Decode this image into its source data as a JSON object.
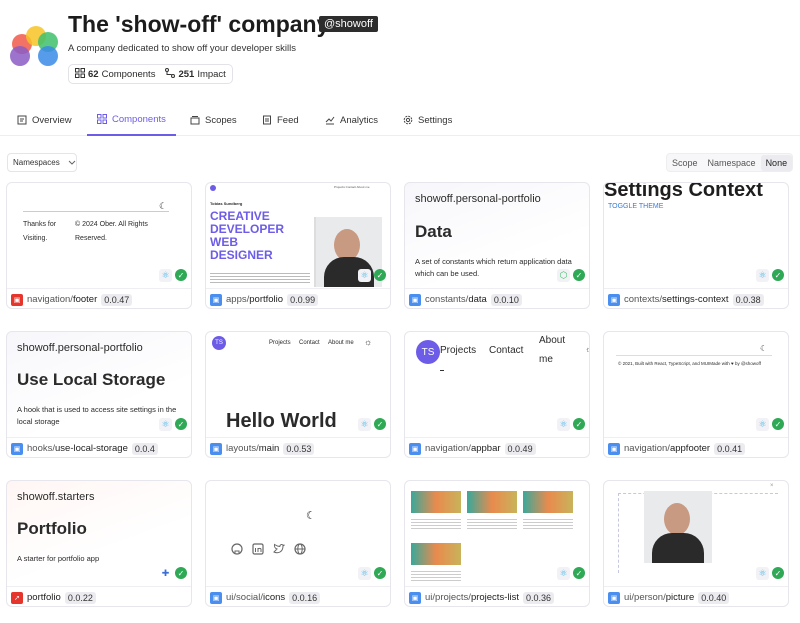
{
  "org": {
    "title": "The 'show-off' company",
    "handle": "@showoff",
    "description": "A company dedicated to show off your developer skills",
    "components_count": "62",
    "components_label": "Components",
    "impact_count": "251",
    "impact_label": "Impact"
  },
  "tabs": [
    {
      "label": "Overview",
      "icon": "overview-icon"
    },
    {
      "label": "Components",
      "icon": "components-icon",
      "active": true
    },
    {
      "label": "Scopes",
      "icon": "scopes-icon"
    },
    {
      "label": "Feed",
      "icon": "feed-icon"
    },
    {
      "label": "Analytics",
      "icon": "analytics-icon"
    },
    {
      "label": "Settings",
      "icon": "gear-icon"
    }
  ],
  "filters": {
    "namespaces_label": "Namespaces",
    "grouping": [
      "Scope",
      "Namespace",
      "None"
    ],
    "grouping_selected": "None"
  },
  "colors": {
    "accent": "#6c5ce7",
    "check": "#2fa955",
    "react": "#47b5e6",
    "env_blue": "#4a8ef0",
    "env_red": "#e5352d"
  },
  "cards": [
    {
      "ns": "navigation/",
      "name": "footer",
      "version": "0.0.47",
      "preview": {
        "thanks": "Thanks for",
        "visiting": "Visiting.",
        "copyright": "© 2024 Ober. All Rights",
        "reserved": "Reserved."
      }
    },
    {
      "ns": "apps/",
      "name": "portfolio",
      "version": "0.0.99",
      "preview": {
        "person": "Tobias Sundberg",
        "headline": [
          "CREATIVE",
          "DEVELOPER",
          "WEB",
          "DESIGNER"
        ],
        "nav": "Projects  Contact  About me"
      }
    },
    {
      "ns": "constants/",
      "name": "data",
      "version": "0.0.10",
      "preview": {
        "scope": "showoff.personal-portfolio",
        "heading": "Data",
        "text": "A set of constants which return application data which can be used."
      }
    },
    {
      "ns": "contexts/",
      "name": "settings-context",
      "version": "0.0.38",
      "preview": {
        "heading": "Settings Context",
        "link": "TOGGLE THEME"
      }
    },
    {
      "ns": "hooks/",
      "name": "use-local-storage",
      "version": "0.0.4",
      "preview": {
        "scope": "showoff.personal-portfolio",
        "heading": "Use Local Storage",
        "text": "A hook that is used to access site settings in the local storage"
      }
    },
    {
      "ns": "layouts/",
      "name": "main",
      "version": "0.0.53",
      "preview": {
        "avatar": "TS",
        "nav": [
          "Projects",
          "Contact",
          "About me"
        ],
        "heading": "Hello World"
      }
    },
    {
      "ns": "navigation/",
      "name": "appbar",
      "version": "0.0.49",
      "preview": {
        "avatar": "TS",
        "nav": [
          "Projects",
          "Contact",
          "About",
          "me"
        ]
      }
    },
    {
      "ns": "navigation/",
      "name": "appfooter",
      "version": "0.0.41",
      "preview": {
        "text": "© 2021, Built with React, TypeScript, and MUIMade with ♥ by @showoff"
      }
    },
    {
      "ns": "",
      "name": "portfolio",
      "version": "0.0.22",
      "preview": {
        "scope": "showoff.starters",
        "heading": "Portfolio",
        "text": "A starter for portfolio app"
      }
    },
    {
      "ns": "ui/social/",
      "name": "icons",
      "version": "0.0.16",
      "preview": {}
    },
    {
      "ns": "ui/projects/",
      "name": "projects-list",
      "version": "0.0.36",
      "preview": {}
    },
    {
      "ns": "ui/person/",
      "name": "picture",
      "version": "0.0.40",
      "preview": {}
    }
  ]
}
